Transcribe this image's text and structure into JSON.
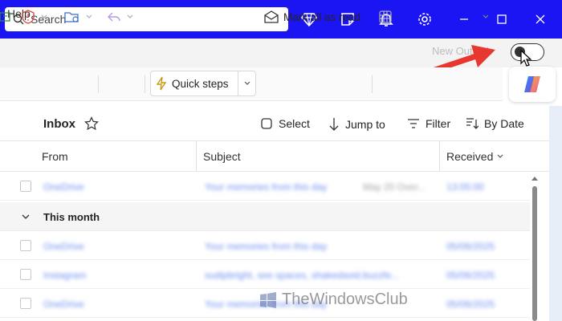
{
  "search": {
    "placeholder": "Search"
  },
  "titlebar": {
    "icons": [
      "premium-diamond-icon",
      "sticky-note-icon",
      "bell-icon",
      "gear-icon",
      "minimize-icon",
      "maximize-icon",
      "close-icon"
    ]
  },
  "menu": {
    "help": "Help"
  },
  "toggle": {
    "label": "New Outlook",
    "state": "off"
  },
  "ribbon": {
    "quick_steps": "Quick steps",
    "mark_all_read": "Mark all as read",
    "copilot": "copilot-icon"
  },
  "list": {
    "title": "Inbox",
    "select": "Select",
    "jump_to": "Jump to",
    "filter": "Filter",
    "sort": "By Date"
  },
  "columns": {
    "from": "From",
    "subject": "Subject",
    "received": "Received"
  },
  "group": {
    "label": "This month"
  },
  "watermark": "TheWindowsClub",
  "colors": {
    "titlebar": "#1a15f2",
    "accent_arrow": "#e8372f"
  }
}
